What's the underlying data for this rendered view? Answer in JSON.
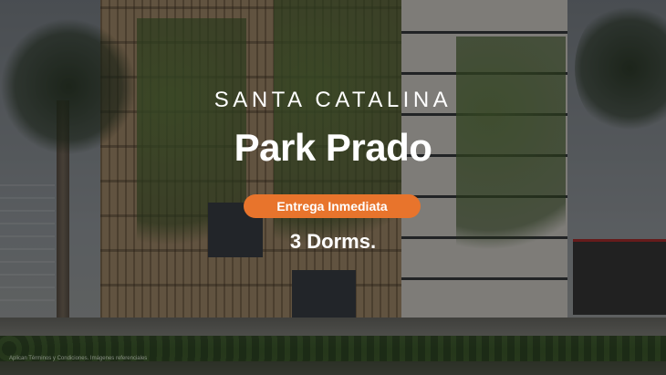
{
  "banner": {
    "district": "SANTA CATALINA",
    "project_name": "Park Prado",
    "delivery_badge": "Entrega Inmediata",
    "bedrooms": "3 Dorms.",
    "disclaimer": "Aplican Términos y Condiciones. Imágenes referenciales"
  },
  "colors": {
    "badge_background": "#e8742c",
    "text": "#ffffff",
    "overlay": "rgba(0,0,0,0.42)"
  }
}
